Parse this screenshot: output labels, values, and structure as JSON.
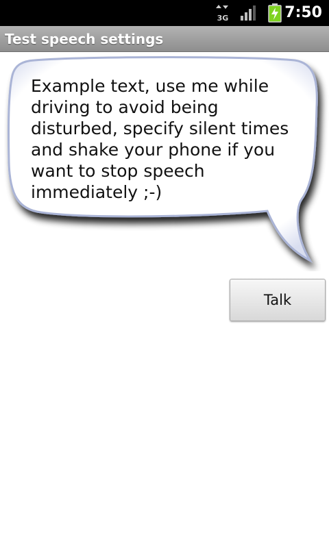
{
  "status_bar": {
    "time": "7:50",
    "network_icon": "3g-data-icon",
    "signal_icon": "signal-strength-icon",
    "battery_icon": "battery-charging-icon",
    "network_label": "3G"
  },
  "title_bar": {
    "title": "Test speech settings"
  },
  "bubble": {
    "text": "Example text, use me while driving to avoid being disturbed, specify silent times and shake your phone if you want to stop speech immediately ;-)"
  },
  "talk_button": {
    "label": "Talk"
  },
  "colors": {
    "status_bar_bg": "#000000",
    "title_bar_bg": "#9e9e9e",
    "bubble_border": "#aeb8d8",
    "battery_green": "#7fd321"
  }
}
